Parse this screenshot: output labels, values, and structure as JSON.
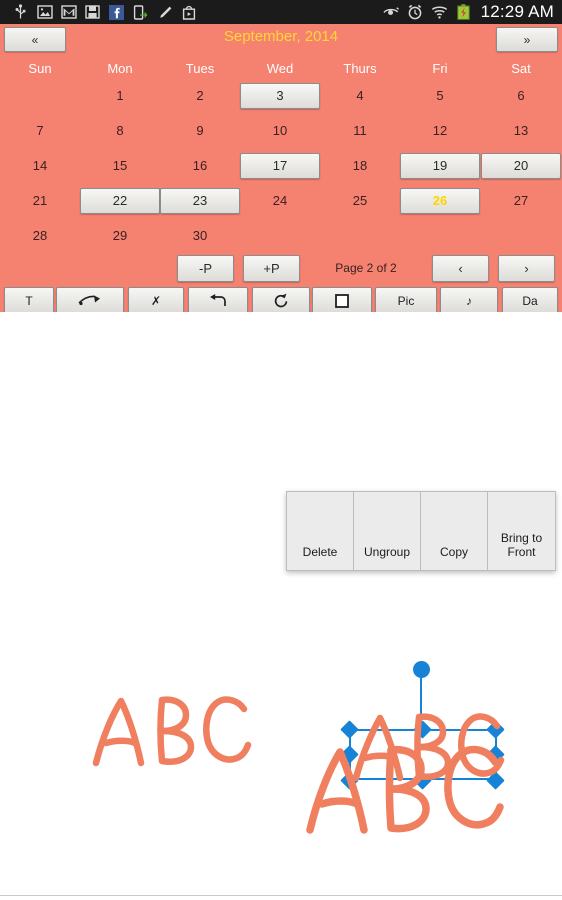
{
  "statusbar": {
    "time": "12:29 AM",
    "left_icons": [
      "usb-icon",
      "image-icon",
      "gmail-icon",
      "save-icon",
      "facebook-icon",
      "device-transfer-icon",
      "pencil-icon",
      "play-store-icon"
    ],
    "right_icons": [
      "eye-icon",
      "alarm-clock-icon",
      "wifi-icon",
      "battery-charging-icon"
    ]
  },
  "calendar": {
    "title": "September, 2014",
    "prev_label": "«",
    "next_label": "»",
    "title_color": "#ffd633",
    "background_color": "#f58170",
    "day_names": [
      "Sun",
      "Mon",
      "Tues",
      "Wed",
      "Thurs",
      "Fri",
      "Sat"
    ],
    "weeks": [
      [
        {
          "day": "",
          "has_event": false,
          "today": false
        },
        {
          "day": "1",
          "has_event": false,
          "today": false
        },
        {
          "day": "2",
          "has_event": false,
          "today": false
        },
        {
          "day": "3",
          "has_event": true,
          "today": false
        },
        {
          "day": "4",
          "has_event": false,
          "today": false
        },
        {
          "day": "5",
          "has_event": false,
          "today": false
        },
        {
          "day": "6",
          "has_event": false,
          "today": false
        }
      ],
      [
        {
          "day": "7",
          "has_event": false,
          "today": false
        },
        {
          "day": "8",
          "has_event": false,
          "today": false
        },
        {
          "day": "9",
          "has_event": false,
          "today": false
        },
        {
          "day": "10",
          "has_event": false,
          "today": false
        },
        {
          "day": "11",
          "has_event": false,
          "today": false
        },
        {
          "day": "12",
          "has_event": false,
          "today": false
        },
        {
          "day": "13",
          "has_event": false,
          "today": false
        }
      ],
      [
        {
          "day": "14",
          "has_event": false,
          "today": false
        },
        {
          "day": "15",
          "has_event": false,
          "today": false
        },
        {
          "day": "16",
          "has_event": false,
          "today": false
        },
        {
          "day": "17",
          "has_event": true,
          "today": false
        },
        {
          "day": "18",
          "has_event": false,
          "today": false
        },
        {
          "day": "19",
          "has_event": true,
          "today": false
        },
        {
          "day": "20",
          "has_event": true,
          "today": false
        }
      ],
      [
        {
          "day": "21",
          "has_event": false,
          "today": false
        },
        {
          "day": "22",
          "has_event": true,
          "today": false
        },
        {
          "day": "23",
          "has_event": true,
          "today": false
        },
        {
          "day": "24",
          "has_event": false,
          "today": false
        },
        {
          "day": "25",
          "has_event": false,
          "today": false
        },
        {
          "day": "26",
          "has_event": true,
          "today": true
        },
        {
          "day": "27",
          "has_event": false,
          "today": false
        }
      ],
      [
        {
          "day": "28",
          "has_event": false,
          "today": false
        },
        {
          "day": "29",
          "has_event": false,
          "today": false
        },
        {
          "day": "30",
          "has_event": false,
          "today": false
        },
        {
          "day": "",
          "has_event": false,
          "today": false
        },
        {
          "day": "",
          "has_event": false,
          "today": false
        },
        {
          "day": "",
          "has_event": false,
          "today": false
        },
        {
          "day": "",
          "has_event": false,
          "today": false
        }
      ]
    ]
  },
  "pagebar": {
    "minus_page": "-P",
    "plus_page": "+P",
    "page_label": "Page 2 of 2",
    "prev_page": "‹",
    "next_page": "›"
  },
  "toolbar": {
    "items": [
      {
        "label": "T",
        "icon": "text-tool-icon"
      },
      {
        "label": "",
        "icon": "pen-stroke-icon"
      },
      {
        "label": "✗",
        "icon": "erase-x-icon"
      },
      {
        "label": "",
        "icon": "undo-icon"
      },
      {
        "label": "",
        "icon": "redo-icon"
      },
      {
        "label": "",
        "icon": "shape-square-icon"
      },
      {
        "label": "Pic",
        "icon": "picture-icon"
      },
      {
        "label": "♪",
        "icon": "audio-note-icon"
      },
      {
        "label": "Da",
        "icon": "data-icon"
      }
    ]
  },
  "canvas": {
    "ink_color": "#f07f5f",
    "selection_color": "#1783d6",
    "strokes": [
      {
        "name": "abc-handwriting-left",
        "text": "A B C"
      },
      {
        "name": "abc-handwriting-selected",
        "text": "A B C"
      },
      {
        "name": "abc-handwriting-background",
        "text": "A B C"
      }
    ]
  },
  "context_menu": {
    "items": [
      {
        "label": "Delete",
        "name": "delete"
      },
      {
        "label": "Ungroup",
        "name": "ungroup"
      },
      {
        "label": "Copy",
        "name": "copy"
      },
      {
        "label": "Bring to\nFront",
        "name": "bring-to-front"
      }
    ]
  }
}
